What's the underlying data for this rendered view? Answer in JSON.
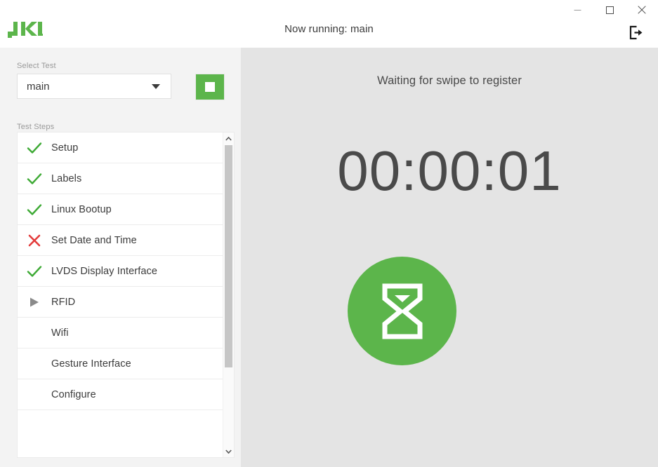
{
  "window": {
    "minimize_label": "Minimize",
    "maximize_label": "Maximize",
    "close_label": "Close",
    "brand_name": "JKI",
    "logout_label": "Log out"
  },
  "header": {
    "now_running": "Now running: main"
  },
  "sidebar": {
    "select_test_label": "Select Test",
    "selected_test": "main",
    "test_options": [
      "main"
    ],
    "stop_button_label": "Stop",
    "test_steps_label": "Test Steps",
    "steps": [
      {
        "label": "Setup",
        "status": "pass"
      },
      {
        "label": "Labels",
        "status": "pass"
      },
      {
        "label": "Linux Bootup",
        "status": "pass"
      },
      {
        "label": "Set Date and Time",
        "status": "fail"
      },
      {
        "label": "LVDS Display Interface",
        "status": "pass"
      },
      {
        "label": "RFID",
        "status": "running"
      },
      {
        "label": "Wifi",
        "status": "none"
      },
      {
        "label": "Gesture Interface",
        "status": "none"
      },
      {
        "label": "Configure",
        "status": "none"
      }
    ]
  },
  "main": {
    "status_message": "Waiting for swipe to register",
    "timer": "00:00:01",
    "status_icon": "hourglass-icon"
  },
  "colors": {
    "brand_green": "#5cb54b",
    "pass_green": "#3eaa35",
    "fail_red": "#e33b3b",
    "running_gray": "#8a8a8a",
    "text_dark": "#3b3b3b",
    "panel_left": "#f3f3f3",
    "panel_right": "#e4e4e4"
  }
}
